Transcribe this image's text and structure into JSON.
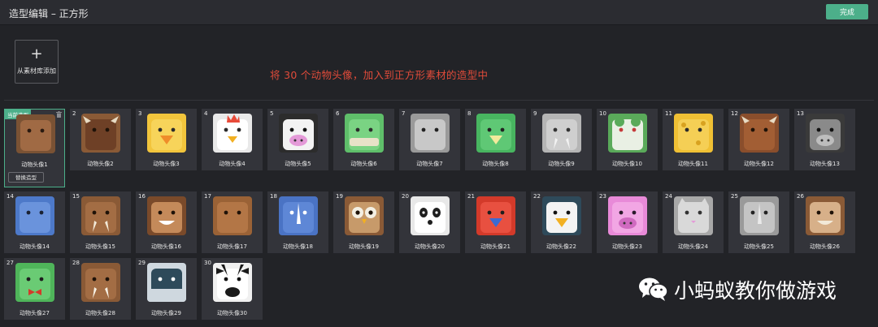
{
  "header": {
    "title": "造型编辑 – 正方形",
    "done_label": "完成"
  },
  "add_button": {
    "plus": "+",
    "label": "从素材库添加"
  },
  "note": "将 30 个动物头像，加入到正方形素材的造型中",
  "current_badge": "当前造型",
  "replace_label": "替换造型",
  "costumes": [
    {
      "num": "1",
      "name": "动物头像1",
      "bg": "#7a5234",
      "face": "#a06a44",
      "eye": "#2a1a10",
      "style": "plain"
    },
    {
      "num": "2",
      "name": "动物头像2",
      "bg": "#8a5a36",
      "face": "#6e4026",
      "eye": "#1e1208",
      "style": "horns"
    },
    {
      "num": "3",
      "name": "动物头像3",
      "bg": "#f2c53c",
      "face": "#f7d45a",
      "eye": "#2b2b2b",
      "style": "beak",
      "accent": "#ef8d2a"
    },
    {
      "num": "4",
      "name": "动物头像4",
      "bg": "#e9e9e9",
      "face": "#ffffff",
      "eye": "#2b2b2b",
      "style": "comb",
      "accent": "#e84b3a"
    },
    {
      "num": "5",
      "name": "动物头像5",
      "bg": "#2c2c2c",
      "face": "#f3f3f3",
      "eye": "#111111",
      "style": "snout",
      "accent": "#e49ad8"
    },
    {
      "num": "6",
      "name": "动物头像6",
      "bg": "#5fbf6a",
      "face": "#7ad383",
      "eye": "#2b2b2b",
      "style": "croc",
      "accent": "#e8e2c8"
    },
    {
      "num": "7",
      "name": "动物头像7",
      "bg": "#9a9a9a",
      "face": "#c8c8c8",
      "eye": "#222222",
      "style": "plain"
    },
    {
      "num": "8",
      "name": "动物头像8",
      "bg": "#48b560",
      "face": "#5fc875",
      "eye": "#222222",
      "style": "beak",
      "accent": "#f3ea9c"
    },
    {
      "num": "9",
      "name": "动物头像9",
      "bg": "#b5b5b5",
      "face": "#cfcfcf",
      "eye": "#333333",
      "style": "tusk",
      "accent": "#f2f2f2"
    },
    {
      "num": "10",
      "name": "动物头像10",
      "bg": "#5aaa5a",
      "face": "#e9f0e4",
      "eye": "#c53a3a",
      "style": "frog"
    },
    {
      "num": "11",
      "name": "动物头像11",
      "bg": "#f0c034",
      "face": "#f5cf55",
      "eye": "#2b2b2b",
      "style": "spots",
      "accent": "#d9a21f"
    },
    {
      "num": "12",
      "name": "动物头像12",
      "bg": "#8a4e2c",
      "face": "#a25e34",
      "eye": "#1e1208",
      "style": "horns"
    },
    {
      "num": "13",
      "name": "动物头像13",
      "bg": "#3a3a3a",
      "face": "#8a8a8a",
      "eye": "#111111",
      "style": "snout",
      "accent": "#bdbdbd"
    },
    {
      "num": "14",
      "name": "动物头像14",
      "bg": "#4d79c9",
      "face": "#6a93dc",
      "eye": "#1a2233",
      "style": "plain"
    },
    {
      "num": "15",
      "name": "动物头像15",
      "bg": "#8a5a36",
      "face": "#a36d44",
      "eye": "#1e1208",
      "style": "tusk",
      "accent": "#f2e9d8"
    },
    {
      "num": "16",
      "name": "动物头像16",
      "bg": "#7a4a2a",
      "face": "#c48a5a",
      "eye": "#1e1208",
      "style": "smile",
      "accent": "#ffffff"
    },
    {
      "num": "17",
      "name": "动物头像17",
      "bg": "#9a6236",
      "face": "#b37646",
      "eye": "#1e1208",
      "style": "plain"
    },
    {
      "num": "18",
      "name": "动物头像18",
      "bg": "#4a73c4",
      "face": "#5e87d6",
      "eye": "#ffffff",
      "style": "horn",
      "accent": "#ffffff"
    },
    {
      "num": "19",
      "name": "动物头像19",
      "bg": "#8a5a36",
      "face": "#c79a6a",
      "eye": "#1e1208",
      "style": "owl",
      "accent": "#f3efe3"
    },
    {
      "num": "20",
      "name": "动物头像20",
      "bg": "#e8e8e8",
      "face": "#ffffff",
      "eye": "#1e1e1e",
      "style": "panda"
    },
    {
      "num": "21",
      "name": "动物头像21",
      "bg": "#d33a2a",
      "face": "#e85040",
      "eye": "#1e1e1e",
      "style": "beak",
      "accent": "#3d6ad2"
    },
    {
      "num": "22",
      "name": "动物头像22",
      "bg": "#2e4a5a",
      "face": "#f3f3f3",
      "eye": "#111111",
      "style": "beak",
      "accent": "#f2b022"
    },
    {
      "num": "23",
      "name": "动物头像23",
      "bg": "#e88ad8",
      "face": "#f2a6e4",
      "eye": "#2a1a2a",
      "style": "snout",
      "accent": "#d06ac0"
    },
    {
      "num": "24",
      "name": "动物头像24",
      "bg": "#a8a8a8",
      "face": "#d9d9d9",
      "eye": "#333333",
      "style": "cat",
      "accent": "#e49ad8"
    },
    {
      "num": "25",
      "name": "动物头像25",
      "bg": "#9a9a9a",
      "face": "#c4c4c4",
      "eye": "#222222",
      "style": "horn",
      "accent": "#eaeaea"
    },
    {
      "num": "26",
      "name": "动物头像26",
      "bg": "#8a5a36",
      "face": "#d7b089",
      "eye": "#1e1208",
      "style": "smile",
      "accent": "#f2e9d8"
    },
    {
      "num": "27",
      "name": "动物头像27",
      "bg": "#4fb55a",
      "face": "#6acb74",
      "eye": "#1e1e1e",
      "style": "bowtie",
      "accent": "#d33a2a"
    },
    {
      "num": "28",
      "name": "动物头像28",
      "bg": "#8a5a36",
      "face": "#a36d44",
      "eye": "#1e1208",
      "style": "tusk",
      "accent": "#f7f2e6"
    },
    {
      "num": "29",
      "name": "动物头像29",
      "bg": "#cfd8df",
      "face": "#2e4a5a",
      "eye": "#ffffff",
      "style": "whale"
    },
    {
      "num": "30",
      "name": "动物头像30",
      "bg": "#f0f0f0",
      "face": "#ffffff",
      "eye": "#111111",
      "style": "zebra",
      "accent": "#1a1a1a"
    }
  ],
  "watermark": {
    "text": "小蚂蚁教你做游戏",
    "logo": "wechat-logo"
  },
  "colors": {
    "accent": "#4caf8a",
    "note": "#e04b3a",
    "background": "#222327"
  }
}
